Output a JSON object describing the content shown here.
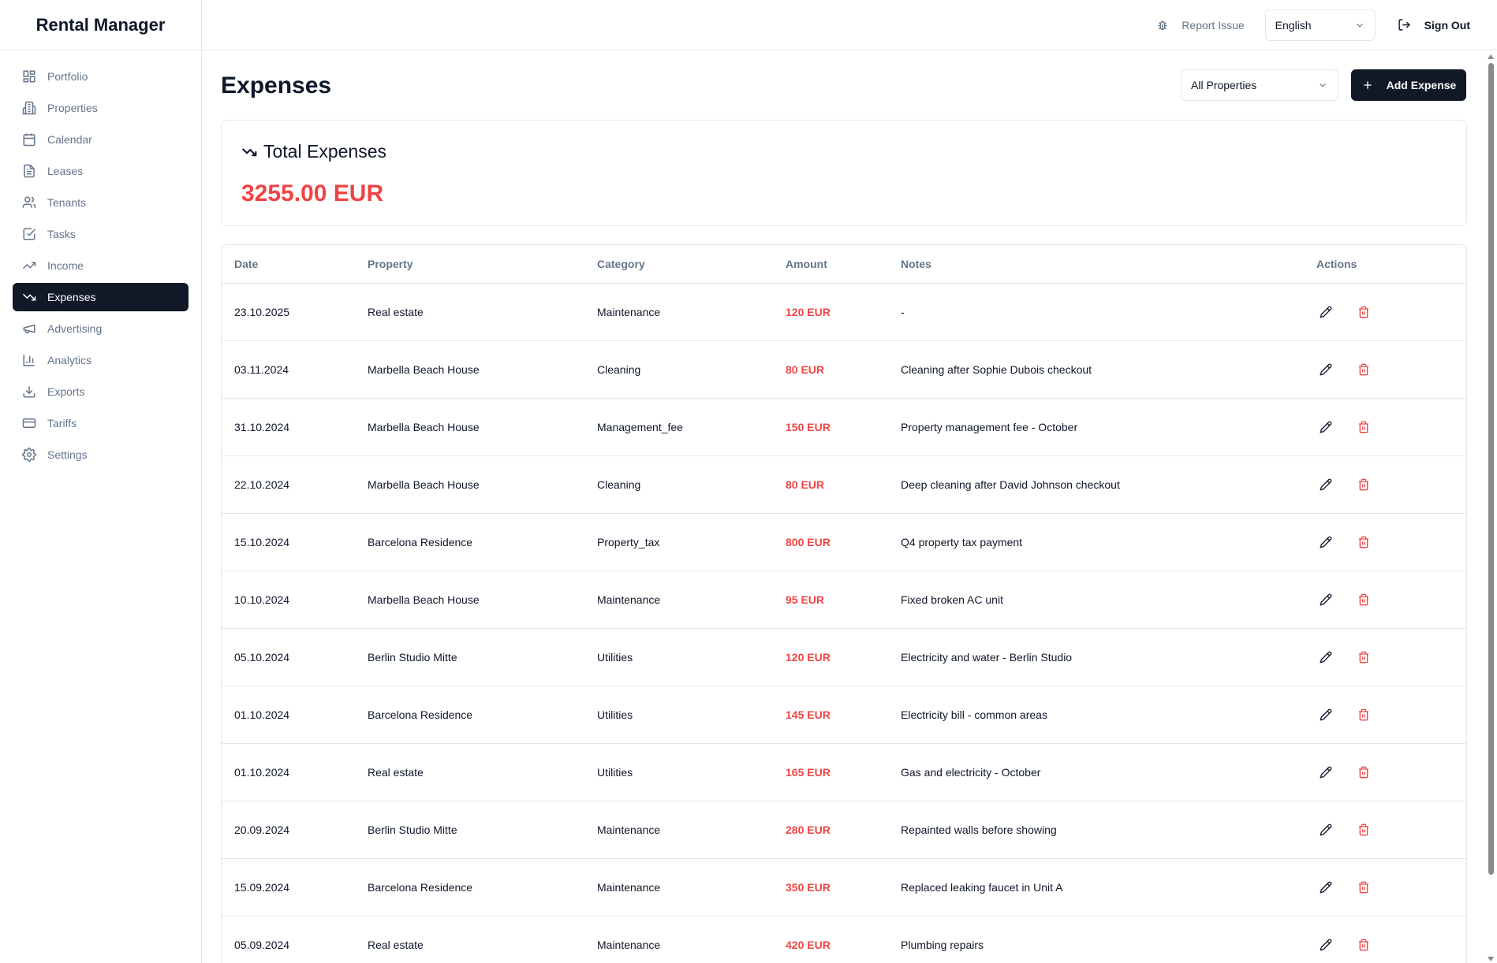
{
  "app": {
    "title": "Rental Manager"
  },
  "sidebar": {
    "items": [
      {
        "label": "Portfolio",
        "icon": "grid-icon"
      },
      {
        "label": "Properties",
        "icon": "building-icon"
      },
      {
        "label": "Calendar",
        "icon": "calendar-icon"
      },
      {
        "label": "Leases",
        "icon": "document-icon"
      },
      {
        "label": "Tenants",
        "icon": "users-icon"
      },
      {
        "label": "Tasks",
        "icon": "check-square-icon"
      },
      {
        "label": "Income",
        "icon": "trending-up-icon"
      },
      {
        "label": "Expenses",
        "icon": "trending-down-icon",
        "active": true
      },
      {
        "label": "Advertising",
        "icon": "megaphone-icon"
      },
      {
        "label": "Analytics",
        "icon": "bar-chart-icon"
      },
      {
        "label": "Exports",
        "icon": "download-icon"
      },
      {
        "label": "Tariffs",
        "icon": "credit-card-icon"
      },
      {
        "label": "Settings",
        "icon": "gear-icon"
      }
    ]
  },
  "topbar": {
    "report_issue": "Report Issue",
    "language": "English",
    "sign_out": "Sign Out"
  },
  "page": {
    "title": "Expenses",
    "property_filter": "All Properties",
    "add_button": "Add Expense"
  },
  "summary": {
    "title": "Total Expenses",
    "value": "3255.00 EUR"
  },
  "table": {
    "headers": [
      "Date",
      "Property",
      "Category",
      "Amount",
      "Notes",
      "Actions"
    ],
    "rows": [
      [
        "23.10.2025",
        "Real estate",
        "Maintenance",
        "120 EUR",
        "-"
      ],
      [
        "03.11.2024",
        "Marbella Beach House",
        "Cleaning",
        "80 EUR",
        "Cleaning after Sophie Dubois checkout"
      ],
      [
        "31.10.2024",
        "Marbella Beach House",
        "Management_fee",
        "150 EUR",
        "Property management fee - October"
      ],
      [
        "22.10.2024",
        "Marbella Beach House",
        "Cleaning",
        "80 EUR",
        "Deep cleaning after David Johnson checkout"
      ],
      [
        "15.10.2024",
        "Barcelona Residence",
        "Property_tax",
        "800 EUR",
        "Q4 property tax payment"
      ],
      [
        "10.10.2024",
        "Marbella Beach House",
        "Maintenance",
        "95 EUR",
        "Fixed broken AC unit"
      ],
      [
        "05.10.2024",
        "Berlin Studio Mitte",
        "Utilities",
        "120 EUR",
        "Electricity and water - Berlin Studio"
      ],
      [
        "01.10.2024",
        "Barcelona Residence",
        "Utilities",
        "145 EUR",
        "Electricity bill - common areas"
      ],
      [
        "01.10.2024",
        "Real estate",
        "Utilities",
        "165 EUR",
        "Gas and electricity - October"
      ],
      [
        "20.09.2024",
        "Berlin Studio Mitte",
        "Maintenance",
        "280 EUR",
        "Repainted walls before showing"
      ],
      [
        "15.09.2024",
        "Barcelona Residence",
        "Maintenance",
        "350 EUR",
        "Replaced leaking faucet in Unit A"
      ],
      [
        "05.09.2024",
        "Real estate",
        "Maintenance",
        "420 EUR",
        "Plumbing repairs"
      ]
    ]
  },
  "colors": {
    "primary": "#111827",
    "expense_red": "#ef4444",
    "muted": "#64748b",
    "border": "#e5e7eb"
  }
}
